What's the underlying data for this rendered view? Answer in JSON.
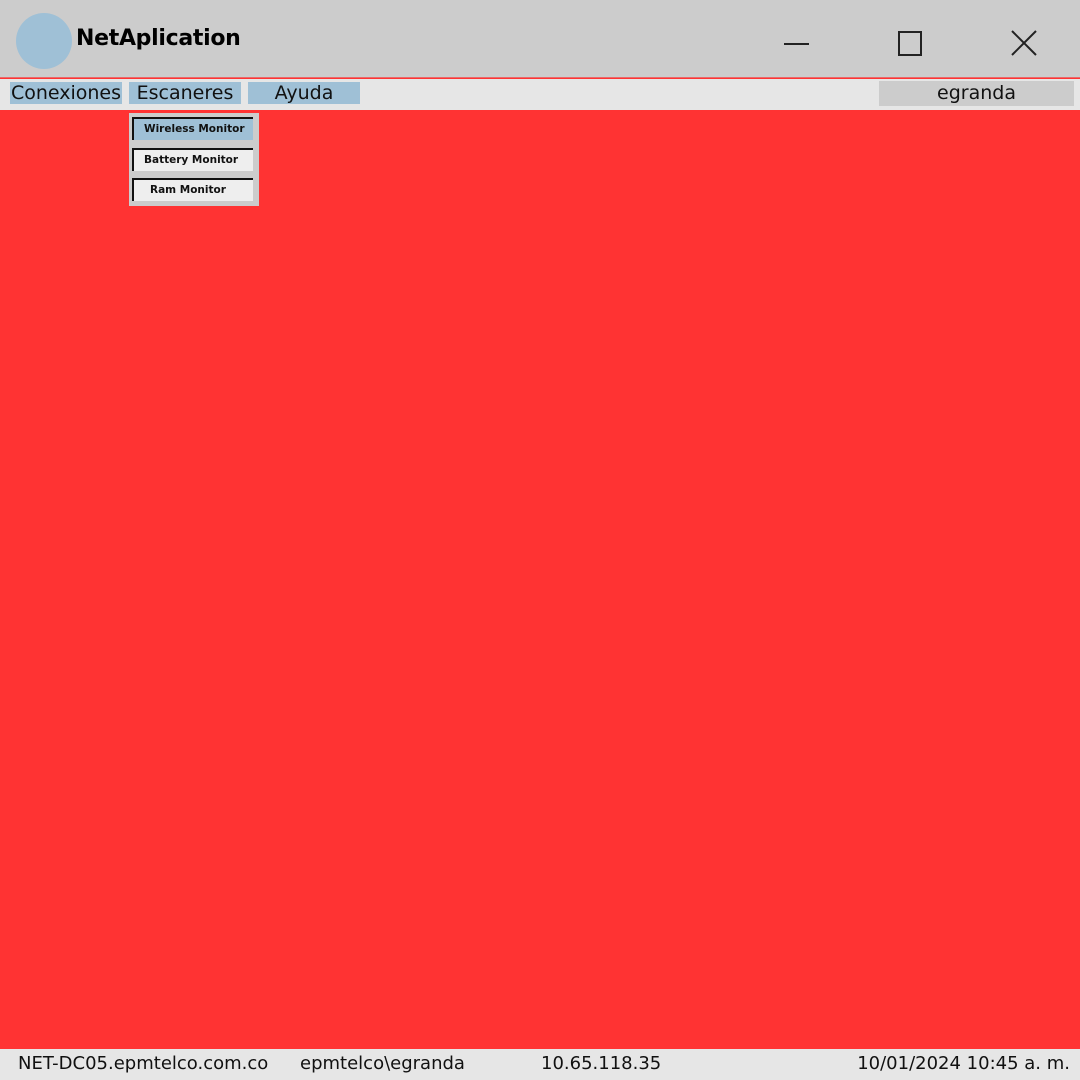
{
  "app": {
    "title": "NetAplication",
    "logo_color": "#9fc0d6"
  },
  "window_controls": {
    "minimize_icon": "minimize-icon",
    "maximize_icon": "maximize-icon",
    "close_icon": "close-icon"
  },
  "menu": {
    "items": [
      {
        "label": "Conexiones"
      },
      {
        "label": "Escaneres"
      },
      {
        "label": "Ayuda"
      }
    ],
    "user": "egranda"
  },
  "dropdown": {
    "parent": "Escaneres",
    "items": [
      {
        "label": "Wireless Monitor",
        "selected": true
      },
      {
        "label": "Battery Monitor",
        "selected": false
      },
      {
        "label": "Ram Monitor",
        "selected": false
      }
    ]
  },
  "status": {
    "host": "NET-DC05.epmtelco.com.co",
    "user": "epmtelco\\egranda",
    "ip": "10.65.118.35",
    "datetime": "10/01/2024 10:45 a. m."
  },
  "colors": {
    "background": "#ff3333",
    "titlebar": "#cccccc",
    "menubar": "#e6e6e6",
    "menu_accent": "#9fc0d6"
  }
}
